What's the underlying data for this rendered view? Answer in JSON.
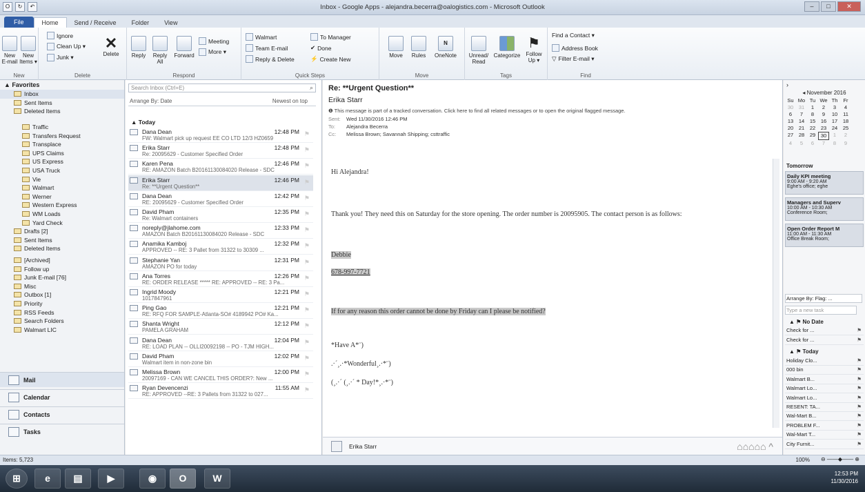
{
  "window": {
    "title": "Inbox - Google Apps - alejandra.becerra@oalogistics.com - Microsoft Outlook"
  },
  "tabs": [
    "File",
    "Home",
    "Send / Receive",
    "Folder",
    "View"
  ],
  "ribbon": {
    "new_email": "New\nE-mail",
    "new_items": "New\nItems ▾",
    "group_new": "New",
    "ignore": "Ignore",
    "clean_up": "Clean Up ▾",
    "junk": "Junk ▾",
    "delete": "Delete",
    "group_delete": "Delete",
    "reply": "Reply",
    "reply_all": "Reply\nAll",
    "forward": "Forward",
    "meeting": "Meeting",
    "more": "More ▾",
    "group_respond": "Respond",
    "qs_walmart": "Walmart",
    "qs_team": "Team E-mail",
    "qs_reply_delete": "Reply & Delete",
    "qs_to_manager": "To Manager",
    "qs_done": "Done",
    "qs_create_new": "Create New",
    "group_quick_steps": "Quick Steps",
    "move": "Move",
    "rules": "Rules",
    "onenote": "OneNote",
    "group_move": "Move",
    "unread_read": "Unread/\nRead",
    "categorize": "Categorize",
    "follow_up": "Follow\nUp ▾",
    "group_tags": "Tags",
    "find_contact": "Find a Contact ▾",
    "address_book": "Address Book",
    "filter_email": "Filter E-mail ▾",
    "group_find": "Find"
  },
  "nav": {
    "favorites_label": "Favorites",
    "favorites": [
      "Inbox",
      "Sent Items",
      "Deleted Items"
    ],
    "folders": [
      "Traffic",
      "Transfers Request",
      "Transplace",
      "UPS Claims",
      "US Express",
      "USA Truck",
      "Vie",
      "Walmart",
      "Werner",
      "Western Express",
      "WM Loads",
      "Yard Check"
    ],
    "root_folders": [
      "Drafts [2]",
      "Sent Items",
      "Deleted Items",
      "[Archived]",
      "Follow up",
      "Junk E-mail [76]",
      "Misc",
      "Outbox [1]",
      "Priority",
      "RSS Feeds",
      "Search Folders",
      "Walmart LIC"
    ],
    "buttons": [
      "Mail",
      "Calendar",
      "Contacts",
      "Tasks"
    ]
  },
  "list": {
    "search_placeholder": "Search Inbox (Ctrl+E)",
    "arrange_by": "Arrange By: Date",
    "order": "Newest on top",
    "today_label": "Today",
    "messages": [
      {
        "from": "Dana Dean",
        "time": "12:48 PM",
        "subject": "FW: Walmart pick up request EE CO LTD 12/3 HZ0659"
      },
      {
        "from": "Erika Starr",
        "time": "12:48 PM",
        "subject": "Re: 20095629 - Customer Specified Order"
      },
      {
        "from": "Karen Pena",
        "time": "12:46 PM",
        "subject": "RE: AMAZON Batch B20161130084020 Release - SDC"
      },
      {
        "from": "Erika Starr",
        "time": "12:46 PM",
        "subject": "Re: **Urgent Question**"
      },
      {
        "from": "Dana Dean",
        "time": "12:42 PM",
        "subject": "RE: 20095629 - Customer Specified Order"
      },
      {
        "from": "David Pham",
        "time": "12:35 PM",
        "subject": "Re: Walmart containers"
      },
      {
        "from": "noreply@jlahome.com",
        "time": "12:33 PM",
        "subject": "AMAZON Batch B20161130084020 Release - SDC"
      },
      {
        "from": "Anamika Kamboj",
        "time": "12:32 PM",
        "subject": "APPROVED -- RE: 3 Pallet from 31322 to 30309 ..."
      },
      {
        "from": "Stephanie Yan",
        "time": "12:31 PM",
        "subject": "AMAZON PO for today"
      },
      {
        "from": "Ana Torres",
        "time": "12:26 PM",
        "subject": "RE: ORDER RELEASE ***** RE: APPROVED -- RE: 3 Pa..."
      },
      {
        "from": "Ingrid Moody",
        "time": "12:21 PM",
        "subject": "1017847961"
      },
      {
        "from": "Ping Gao",
        "time": "12:21 PM",
        "subject": "RE: RFQ FOR SAMPLE-Atlanta-SO# 4189942 PO# Ka..."
      },
      {
        "from": "Shanta Wright",
        "time": "12:12 PM",
        "subject": "PAMELA GRAHAM"
      },
      {
        "from": "Dana Dean",
        "time": "12:04 PM",
        "subject": "RE: LOAD PLAN -- OLLI20092198 -- PO - TJM HIGH..."
      },
      {
        "from": "David Pham",
        "time": "12:02 PM",
        "subject": "Walmart item in non-zone bin"
      },
      {
        "from": "Melissa Brown",
        "time": "12:00 PM",
        "subject": "20097169 - CAN WE CANCEL THIS ORDER?: New ..."
      },
      {
        "from": "Ryan Devencenzi",
        "time": "11:55 AM",
        "subject": "RE: APPROVED --RE: 3 Pallets from 31322 to 027..."
      }
    ]
  },
  "reading": {
    "subject": "Re: **Urgent Question**",
    "from": "Erika Starr",
    "info": "This message is part of a tracked conversation. Click here to find all related messages or to open the original flagged message.",
    "sent_label": "Sent:",
    "sent": "Wed 11/30/2016 12:46 PM",
    "to_label": "To:",
    "to": "Alejandra Becerra",
    "cc_label": "Cc:",
    "cc": "Melissa Brown; Savannah Shipping; csttraffic",
    "greeting": "Hi Alejandra!",
    "para1": "Thank you! They need this on Saturday for the store opening. The order number is 20095905. The contact person is as follows:",
    "contact_name": "Debbie",
    "contact_phone": "678-997-7721",
    "para2": "If for any reason this order cannot be done by Friday can I please be notified?",
    "sig1": "*Have A*¨)",
    "sig2": ".·´¸.·*Wonderful¸.·*¨)",
    "sig3": "(¸.·´ (¸.·´ * Day!*¸.·*¨)",
    "footer_name": "Erika Starr"
  },
  "todo": {
    "month": "November 2016",
    "weekdays": [
      "Su",
      "Mo",
      "Tu",
      "We",
      "Th",
      "Fr"
    ],
    "weeks": [
      [
        "30",
        "31",
        "1",
        "2",
        "3",
        "4"
      ],
      [
        "6",
        "7",
        "8",
        "9",
        "10",
        "11"
      ],
      [
        "13",
        "14",
        "15",
        "16",
        "17",
        "18"
      ],
      [
        "20",
        "21",
        "22",
        "23",
        "24",
        "25"
      ],
      [
        "27",
        "28",
        "29",
        "30",
        "1",
        "2"
      ],
      [
        "4",
        "5",
        "6",
        "7",
        "8",
        "9"
      ]
    ],
    "tomorrow": "Tomorrow",
    "appointments": [
      {
        "title": "Daily KPI meeting",
        "detail": "9:00 AM - 9:20 AM",
        "place": "Eghe's office; eghe"
      },
      {
        "title": "Managers and Superv",
        "detail": "10:00 AM - 10:30 AM",
        "place": "Conference Room;"
      },
      {
        "title": "Open Order Report M",
        "detail": "11:00 AM - 11:30 AM",
        "place": "Office Break Room;"
      }
    ],
    "arrange": "Arrange By: Flag: ...",
    "new_task": "Type a new task",
    "no_date": "No Date",
    "no_date_tasks": [
      "Check for ...",
      "Check for ..."
    ],
    "today": "Today",
    "today_tasks": [
      "Holiday Clo...",
      "000 bin",
      "Walmart B...",
      "Walmart Lo...",
      "Walmart Lo...",
      "RESENT: TA...",
      "Wal-Mart B...",
      "PROBLEM F...",
      "Wal-Mart T...",
      "City Furnit..."
    ]
  },
  "status": {
    "items": "Items: 5,723",
    "zoom": "100%"
  },
  "taskbar": {
    "time": "12:53 PM",
    "date": "11/30/2016"
  }
}
